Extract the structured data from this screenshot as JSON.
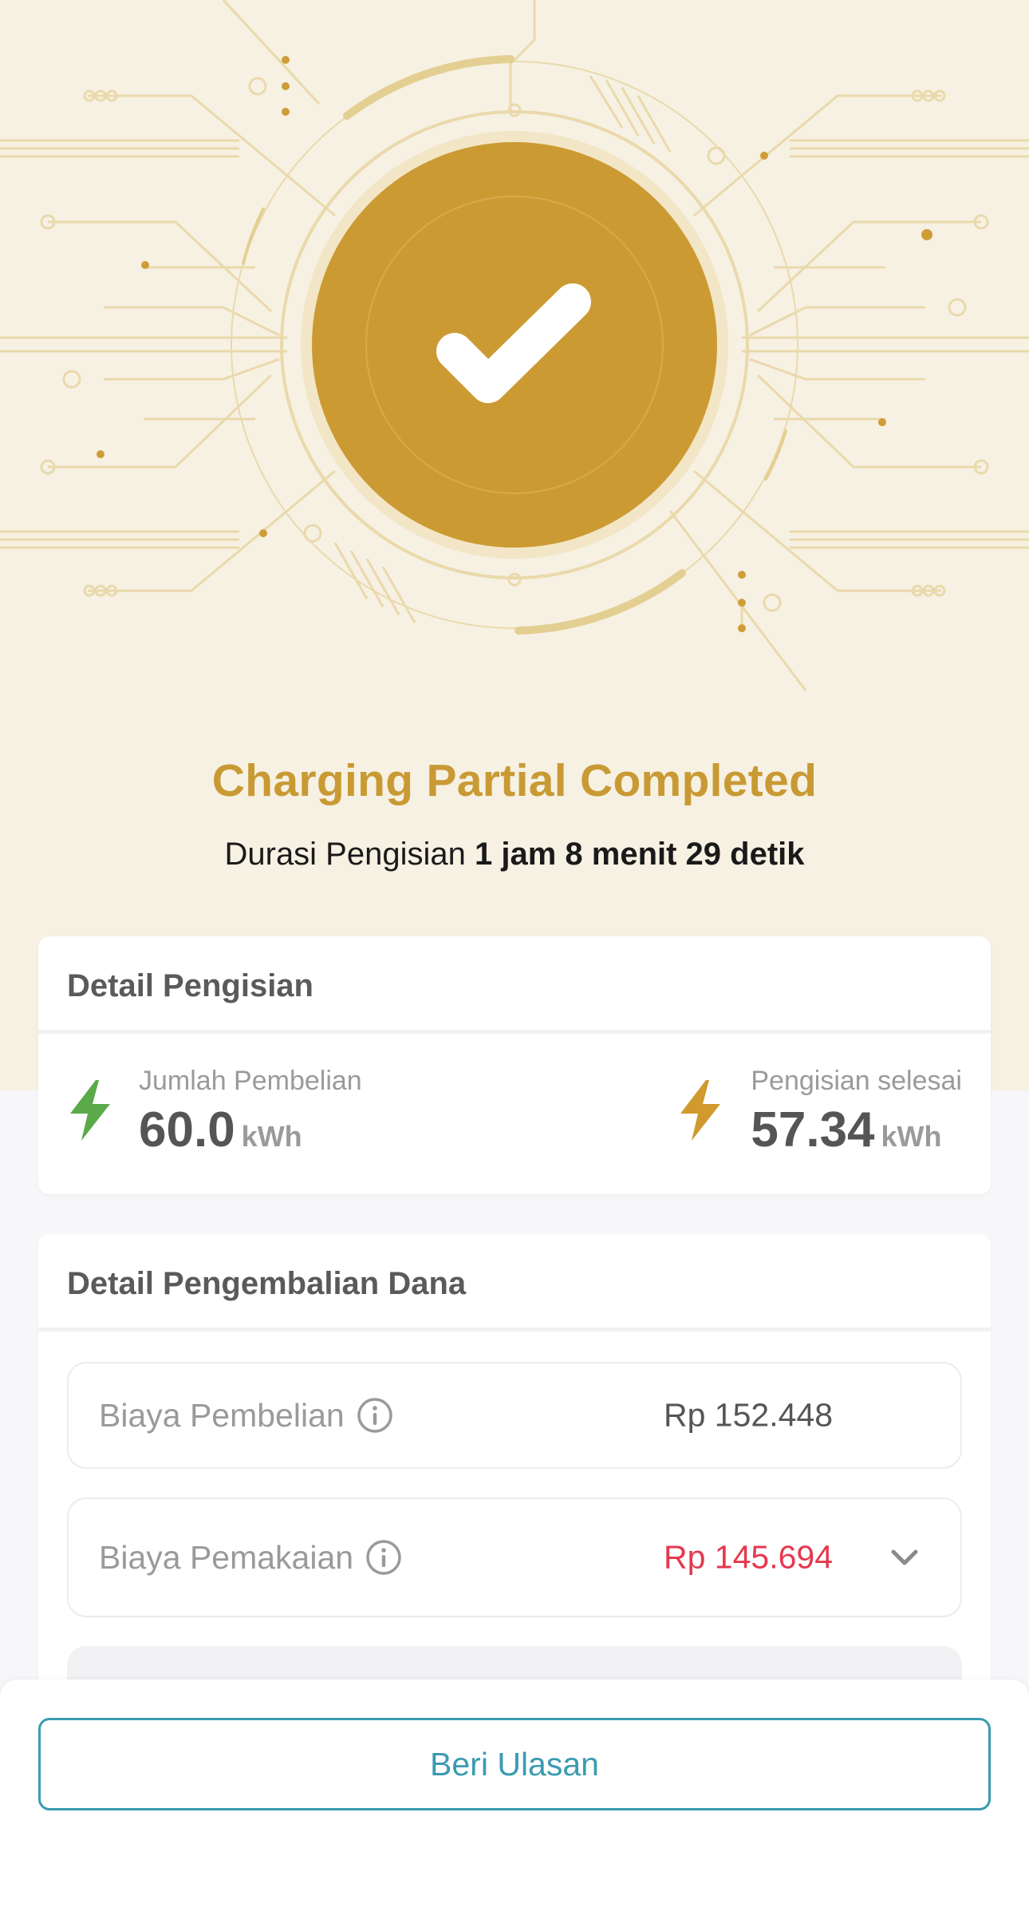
{
  "status": {
    "title": "Charging Partial Completed",
    "duration_label": "Durasi Pengisian",
    "duration_value": "1 jam 8 menit 29 detik"
  },
  "detail_pengisian": {
    "header": "Detail Pengisian",
    "purchased": {
      "label": "Jumlah Pembelian",
      "value": "60.0",
      "unit": "kWh",
      "icon": "lightning-bolt-icon",
      "color": "#5aaa4a"
    },
    "completed": {
      "label": "Pengisian selesai",
      "value": "57.34",
      "unit": "kWh",
      "icon": "lightning-bolt-icon",
      "color": "#d09a2e"
    }
  },
  "detail_pengembalian": {
    "header": "Detail Pengembalian Dana",
    "rows": [
      {
        "label": "Biaya Pembelian",
        "value": "Rp 152.448",
        "icon": "info-icon"
      },
      {
        "label": "Biaya Pemakaian",
        "value": "Rp 145.694",
        "icon": "info-icon",
        "value_color": "#e5384f"
      }
    ]
  },
  "footer": {
    "review_button": "Beri Ulasan"
  },
  "colors": {
    "accent_gold": "#c99a34",
    "hero_bg": "#f6f1e3",
    "button_teal": "#3a9bb1"
  }
}
